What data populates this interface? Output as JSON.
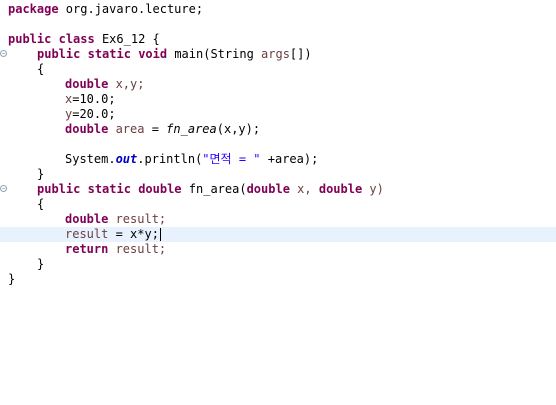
{
  "editor": {
    "language": "java",
    "lines": {
      "l1": {
        "kw": "package",
        "rest": " org.javaro.lecture;"
      },
      "l3": {
        "kw1": "public",
        "kw2": "class",
        "name": " Ex6_12 {"
      },
      "l4": {
        "kw1": "public",
        "kw2": "static",
        "kw3": "void",
        "sig": " main(String ",
        "arg": "args",
        "end": "[])"
      },
      "l5": {
        "text": "{"
      },
      "l6": {
        "kw": "double",
        "rest": " x,y;"
      },
      "l7": {
        "v": "x",
        "rest": "=10.0;"
      },
      "l8": {
        "v": "y",
        "rest": "=20.0;"
      },
      "l9": {
        "kw": "double",
        "v": " area",
        "eq": " = ",
        "fn": "fn_area",
        "args": "(x,y);"
      },
      "l11": {
        "pre": "System.",
        "fld": "out",
        "mid": ".println(",
        "str": "\"면적 = \"",
        "end": " +area);"
      },
      "l12": {
        "text": "}"
      },
      "l13": {
        "kw1": "public",
        "kw2": "static",
        "kw3": "double",
        "sig": " fn_area(",
        "kw4": "double",
        "p1": " x, ",
        "kw5": "double",
        "p2": " y)"
      },
      "l14": {
        "text": "{"
      },
      "l15": {
        "kw": "double",
        "v": " result;"
      },
      "l16": {
        "v": "result",
        "rest": " = x*y;"
      },
      "l17": {
        "kw": "return",
        "v": " result;"
      },
      "l18": {
        "text": "}"
      },
      "l19": {
        "text": "}"
      }
    }
  },
  "colors": {
    "keyword": "#7f0055",
    "local_variable": "#6a3e3e",
    "static_field": "#0000c0",
    "string": "#2a00ff",
    "current_line": "#e8f2fe"
  }
}
